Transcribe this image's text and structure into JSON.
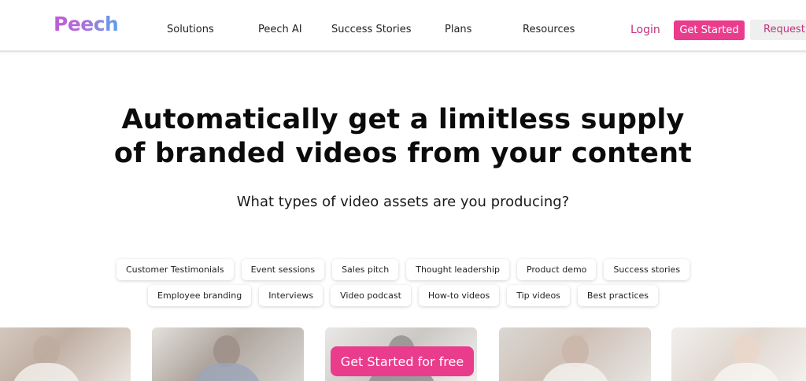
{
  "header": {
    "logo": "Peech",
    "nav": [
      "Solutions",
      "Peech AI",
      "Success Stories",
      "Plans",
      "Resources"
    ],
    "login": "Login",
    "get_started": "Get Started",
    "request": "Request"
  },
  "hero": {
    "headline_line1": "Automatically get a limitless supply",
    "headline_line2": "of branded videos from your content",
    "subline": "What types of video assets are you producing?"
  },
  "chips_row1": [
    "Customer Testimonials",
    "Event sessions",
    "Sales pitch",
    "Thought leadership",
    "Product demo",
    "Success stories"
  ],
  "chips_row2": [
    "Employee branding",
    "Interviews",
    "Video podcast",
    "How-to videos",
    "Tip videos",
    "Best practices"
  ],
  "cta": "Get Started for free",
  "colors": {
    "accent": "#ea3c8c",
    "login_text": "#c0337e"
  }
}
